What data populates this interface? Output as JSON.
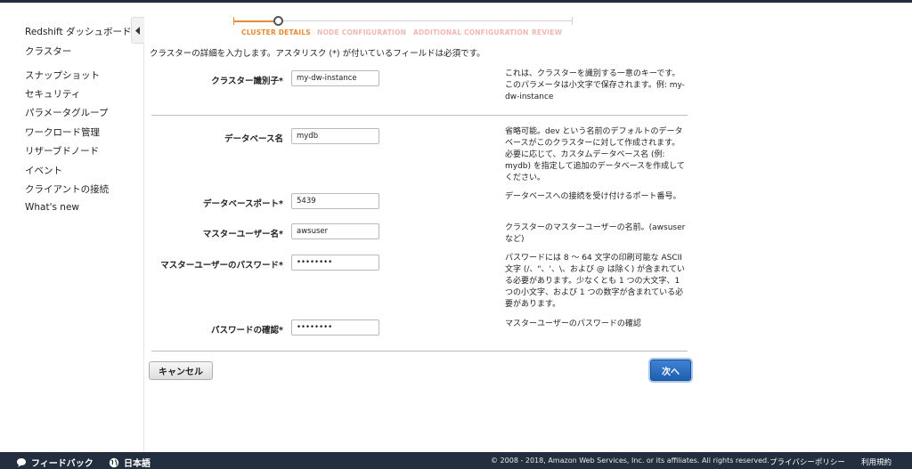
{
  "sidebar": {
    "items": [
      {
        "label": "Redshift ダッシュボード"
      },
      {
        "label": "クラスター"
      },
      {
        "label": "スナップショット"
      },
      {
        "label": "セキュリティ"
      },
      {
        "label": "パラメータグループ"
      },
      {
        "label": "ワークロード管理"
      },
      {
        "label": "リザーブドノード"
      },
      {
        "label": "イベント"
      },
      {
        "label": "クライアントの接続"
      },
      {
        "label": "What's new"
      }
    ]
  },
  "wizard": {
    "steps": [
      {
        "label": "CLUSTER DETAILS",
        "state": "active"
      },
      {
        "label": "NODE CONFIGURATION",
        "state": "inactive"
      },
      {
        "label": "ADDITIONAL CONFIGURATION",
        "state": "inactive"
      },
      {
        "label": "REVIEW",
        "state": "inactive"
      }
    ],
    "intro": "クラスターの詳細を入力します。アスタリスク (*) が付いているフィールドは必須です。"
  },
  "form": {
    "cluster_identifier": {
      "label": "クラスター識別子*",
      "value": "my-dw-instance",
      "help": "これは、クラスターを識別する一意のキーです。このパラメータは小文字で保存されます。例: my-dw-instance"
    },
    "database_name": {
      "label": "データベース名",
      "value": "mydb",
      "help": "省略可能。dev という名前のデフォルトのデータベースがこのクラスターに対して作成されます。必要に応じて、カスタムデータベース名 (例: mydb) を指定して追加のデータベースを作成してください。"
    },
    "database_port": {
      "label": "データベースポート*",
      "value": "5439",
      "help": "データベースへの接続を受け付けるポート番号。"
    },
    "master_user": {
      "label": "マスターユーザー名*",
      "value": "awsuser",
      "help": "クラスターのマスターユーザーの名前。(awsuser など)"
    },
    "master_password": {
      "label": "マスターユーザーのパスワード*",
      "value": "••••••••",
      "help": "パスワードには 8 ～ 64 文字の印刷可能な ASCII 文字 (/、\"、'、\\、および @ は除く) が含まれている必要があります。少なくとも 1 つの大文字、1 つの小文字、および 1 つの数字が含まれている必要があります。"
    },
    "confirm_password": {
      "label": "パスワードの確認*",
      "value": "••••••••",
      "help": "マスターユーザーのパスワードの確認"
    }
  },
  "buttons": {
    "cancel": "キャンセル",
    "next": "次へ"
  },
  "footer": {
    "feedback": "フィードバック",
    "language": "日本語",
    "copyright": "© 2008 - 2018, Amazon Web Services, Inc. or its affiliates. All rights reserved.",
    "privacy": "プライバシーポリシー",
    "terms": "利用規約"
  },
  "colors": {
    "accent": "#e88a33",
    "primary_button": "#2a6ec6",
    "footer_bg": "#232f3e"
  }
}
